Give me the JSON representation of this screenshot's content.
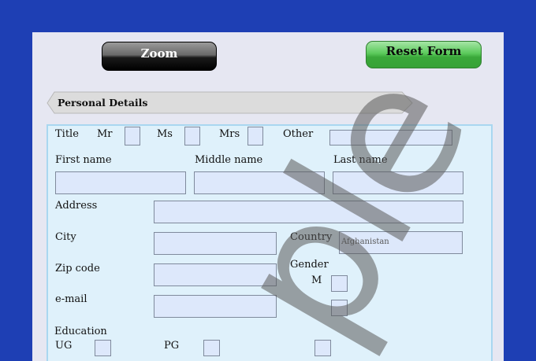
{
  "toolbar": {
    "zoom_label": "Zoom",
    "reset_label": "Reset Form"
  },
  "section": {
    "title": "Personal Details"
  },
  "form": {
    "title_label": "Title",
    "title_options": [
      "Mr",
      "Ms",
      "Mrs"
    ],
    "other_label": "Other",
    "first_name_label": "First name",
    "middle_name_label": "Middle name",
    "last_name_label": "Last name",
    "address_label": "Address",
    "city_label": "City",
    "country_label": "Country",
    "country_value": "Afghanistan",
    "zip_label": "Zip code",
    "gender_label": "Gender",
    "gender_m_label": "M",
    "email_label": "e-mail",
    "education_label": "Education",
    "education_options": [
      "UG",
      "PG"
    ]
  },
  "watermark": {
    "text": "ple"
  },
  "colors": {
    "background": "#1e3fb4",
    "panel": "#dff1fb",
    "field": "#dde8fb",
    "reset": "#4cba4c"
  }
}
